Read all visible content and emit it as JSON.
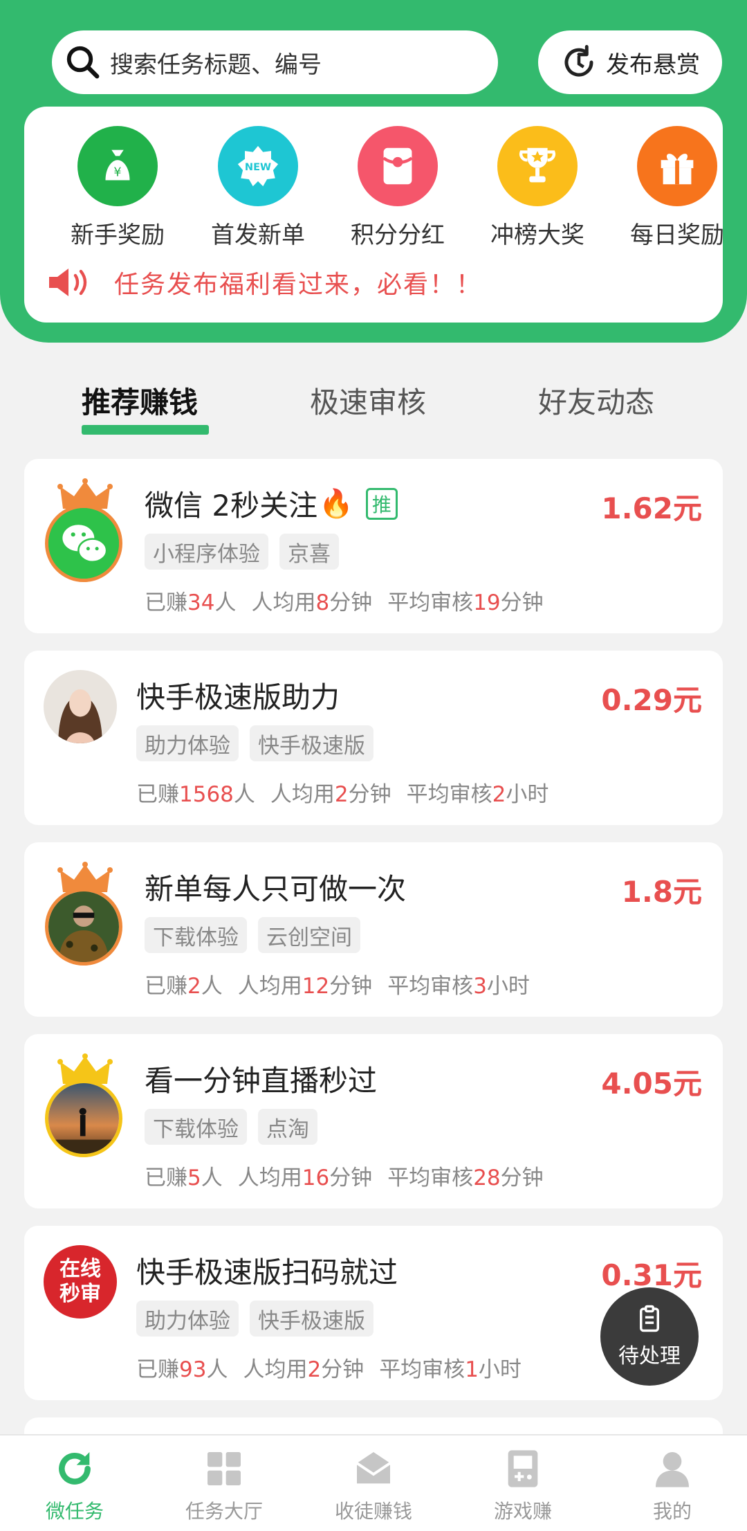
{
  "search": {
    "placeholder": "搜索任务标题、编号"
  },
  "publish_label": "发布悬赏",
  "quick_entries": [
    {
      "label": "新手奖励",
      "icon": "money-bag-icon",
      "color": "#21b14a"
    },
    {
      "label": "首发新单",
      "icon": "new-badge-icon",
      "color": "#1ec6d3"
    },
    {
      "label": "积分分红",
      "icon": "red-envelope-icon",
      "color": "#f5566b"
    },
    {
      "label": "冲榜大奖",
      "icon": "trophy-icon",
      "color": "#fbbd1a"
    },
    {
      "label": "每日奖励",
      "icon": "gift-icon",
      "color": "#f7741c"
    }
  ],
  "notice": "任务发布福利看过来，必看！！",
  "tabs": [
    "推荐赚钱",
    "极速审核",
    "好友动态"
  ],
  "tasks": [
    {
      "title": "微信 2秒关注",
      "badge": "推",
      "price": "1.62元",
      "tags": [
        "小程序体验",
        "京喜"
      ],
      "stats": {
        "p1": "已赚",
        "n1": "34",
        "s1": "人",
        "p2": "人均用",
        "n2": "8",
        "s2": "分钟",
        "p3": "平均审核",
        "n3": "19",
        "s3": "分钟"
      },
      "crown": "orange"
    },
    {
      "title": "快手极速版助力",
      "price": "0.29元",
      "tags": [
        "助力体验",
        "快手极速版"
      ],
      "stats": {
        "p1": "已赚",
        "n1": "1568",
        "s1": "人",
        "p2": "人均用",
        "n2": "2",
        "s2": "分钟",
        "p3": "平均审核",
        "n3": "2",
        "s3": "小时"
      }
    },
    {
      "title": "新单每人只可做一次",
      "price": "1.8元",
      "tags": [
        "下载体验",
        "云创空间"
      ],
      "stats": {
        "p1": "已赚",
        "n1": "2",
        "s1": "人",
        "p2": "人均用",
        "n2": "12",
        "s2": "分钟",
        "p3": "平均审核",
        "n3": "3",
        "s3": "小时"
      },
      "crown": "orange"
    },
    {
      "title": "看一分钟直播秒过",
      "price": "4.05元",
      "tags": [
        "下载体验",
        "点淘"
      ],
      "stats": {
        "p1": "已赚",
        "n1": "5",
        "s1": "人",
        "p2": "人均用",
        "n2": "16",
        "s2": "分钟",
        "p3": "平均审核",
        "n3": "28",
        "s3": "分钟"
      },
      "crown": "gold"
    },
    {
      "title": "快手极速版扫码就过",
      "price": "0.31元",
      "tags": [
        "助力体验",
        "快手极速版"
      ],
      "stats": {
        "p1": "已赚",
        "n1": "93",
        "s1": "人",
        "p2": "人均用",
        "n2": "2",
        "s2": "分钟",
        "p3": "平均审核",
        "n3": "1",
        "s3": "小时"
      },
      "avatar_text": "在线秒审"
    }
  ],
  "pending_label": "待处理",
  "bottom_nav": [
    "微任务",
    "任务大厅",
    "收徒赚钱",
    "游戏赚",
    "我的"
  ],
  "colors": {
    "brand_green": "#33ba6e",
    "price_red": "#e84f4f"
  }
}
